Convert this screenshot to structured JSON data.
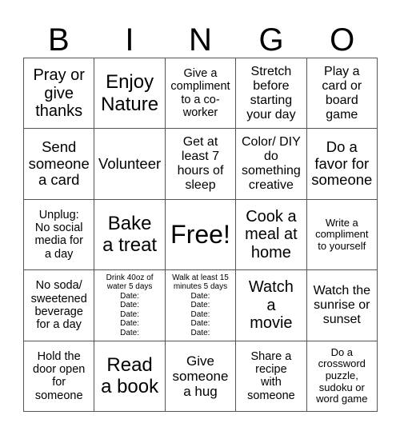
{
  "header": [
    "B",
    "I",
    "N",
    "G",
    "O"
  ],
  "cells": [
    {
      "text": "Pray or\ngive\nthanks",
      "size": "s20"
    },
    {
      "text": "Enjoy\nNature",
      "size": "s24"
    },
    {
      "text": "Give a\ncompliment\nto a co-\nworker",
      "size": "s14"
    },
    {
      "text": "Stretch\nbefore\nstarting\nyour day",
      "size": "s16"
    },
    {
      "text": "Play a\ncard or\nboard\ngame",
      "size": "s16"
    },
    {
      "text": "Send\nsomeone\na card",
      "size": "s18"
    },
    {
      "text": "Volunteer",
      "size": "s18"
    },
    {
      "text": "Get at\nleast 7\nhours of\nsleep",
      "size": "s16"
    },
    {
      "text": "Color/ DIY\ndo\nsomething\ncreative",
      "size": "s16"
    },
    {
      "text": "Do a\nfavor for\nsomeone",
      "size": "s18"
    },
    {
      "text": "Unplug:\nNo social\nmedia for\na day",
      "size": "s14"
    },
    {
      "text": "Bake\na treat",
      "size": "s24"
    },
    {
      "text": "Free!",
      "size": "s32"
    },
    {
      "text": "Cook a\nmeal at\nhome",
      "size": "s20"
    },
    {
      "text": "Write a\ncompliment\nto yourself",
      "size": "s13"
    },
    {
      "text": "No soda/\nsweetened\nbeverage\nfor a day",
      "size": "s14"
    },
    {
      "text": "Drink 40oz of\nwater 5 days\nDate:\nDate:\nDate:\nDate:\nDate:",
      "size": "s10"
    },
    {
      "text": "Walk at least 15\nminutes 5 days\nDate:\nDate:\nDate:\nDate:\nDate:",
      "size": "s10"
    },
    {
      "text": "Watch\na\nmovie",
      "size": "s20"
    },
    {
      "text": "Watch the\nsunrise or\nsunset",
      "size": "s16"
    },
    {
      "text": "Hold the\ndoor open\nfor\nsomeone",
      "size": "s14"
    },
    {
      "text": "Read\na book",
      "size": "s24"
    },
    {
      "text": "Give\nsomeone\na hug",
      "size": "s17"
    },
    {
      "text": "Share a\nrecipe\nwith\nsomeone",
      "size": "s14"
    },
    {
      "text": "Do a\ncrossword\npuzzle,\nsudoku or\nword game",
      "size": "s13"
    }
  ]
}
